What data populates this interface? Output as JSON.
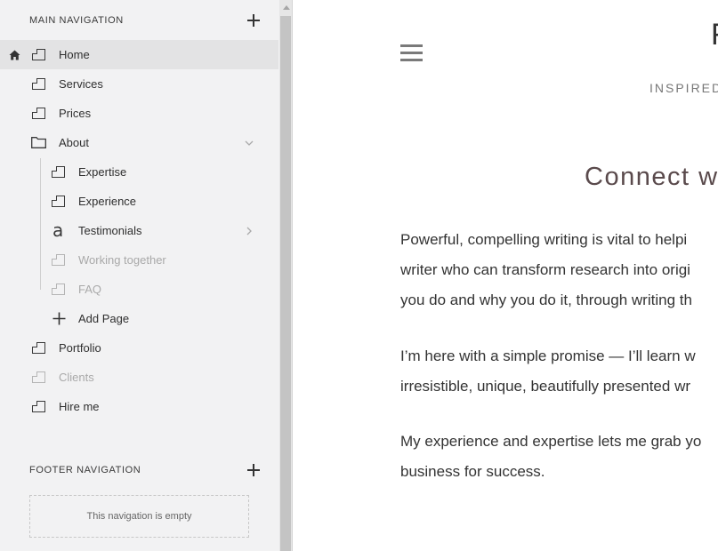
{
  "sidebar": {
    "main_nav_title": "MAIN NAVIGATION",
    "footer_nav_title": "FOOTER NAVIGATION",
    "footer_empty_text": "This navigation is empty",
    "items": [
      {
        "label": "Home"
      },
      {
        "label": "Services"
      },
      {
        "label": "Prices"
      },
      {
        "label": "About"
      },
      {
        "label": "Expertise"
      },
      {
        "label": "Experience"
      },
      {
        "label": "Testimonials"
      },
      {
        "label": "Working together"
      },
      {
        "label": "FAQ"
      },
      {
        "label": "Add Page"
      },
      {
        "label": "Portfolio"
      },
      {
        "label": "Clients"
      },
      {
        "label": "Hire me"
      }
    ]
  },
  "preview": {
    "site_title_partial": "F",
    "tagline_partial": "INSPIRED",
    "heading_partial": "Connect w",
    "paragraphs": [
      [
        "Powerful, compelling writing is vital to helpi",
        "writer who can transform research into origi",
        "you do and why you do it, through writing th"
      ],
      [
        "I’m here with a simple promise — I’ll learn w",
        "irresistible, unique, beautifully presented wr"
      ],
      [
        "My experience and expertise lets me grab yo",
        "business for success."
      ]
    ]
  }
}
